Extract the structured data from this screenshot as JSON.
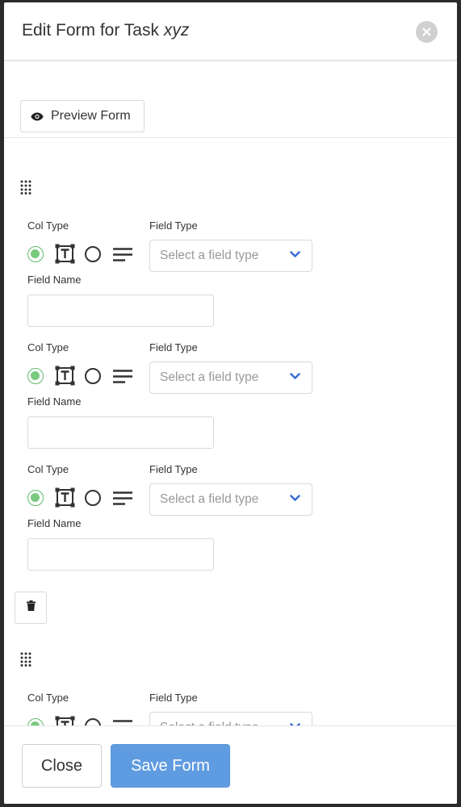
{
  "modal": {
    "title_prefix": "Edit Form for Task ",
    "title_task": "xyz"
  },
  "toolbar": {
    "preview_label": "Preview Form"
  },
  "labels": {
    "col_type": "Col Type",
    "field_type": "Field Type",
    "field_name": "Field Name"
  },
  "select": {
    "placeholder": "Select a field type"
  },
  "rows": [
    {
      "field_name": "",
      "col_type_selected": "text"
    },
    {
      "field_name": "",
      "col_type_selected": "text"
    },
    {
      "field_name": "",
      "col_type_selected": "text"
    },
    {
      "field_name": "",
      "col_type_selected": "text"
    }
  ],
  "footer": {
    "close_label": "Close",
    "save_label": "Save Form"
  },
  "colors": {
    "accent": "#5f9be0",
    "radio_selected": "#79c97f",
    "chevron": "#3b6fd6"
  },
  "icons": [
    "close-icon",
    "eye-icon",
    "drag-handle-icon",
    "text-box-icon",
    "paragraph-icon",
    "chevron-down-icon",
    "trash-icon"
  ]
}
